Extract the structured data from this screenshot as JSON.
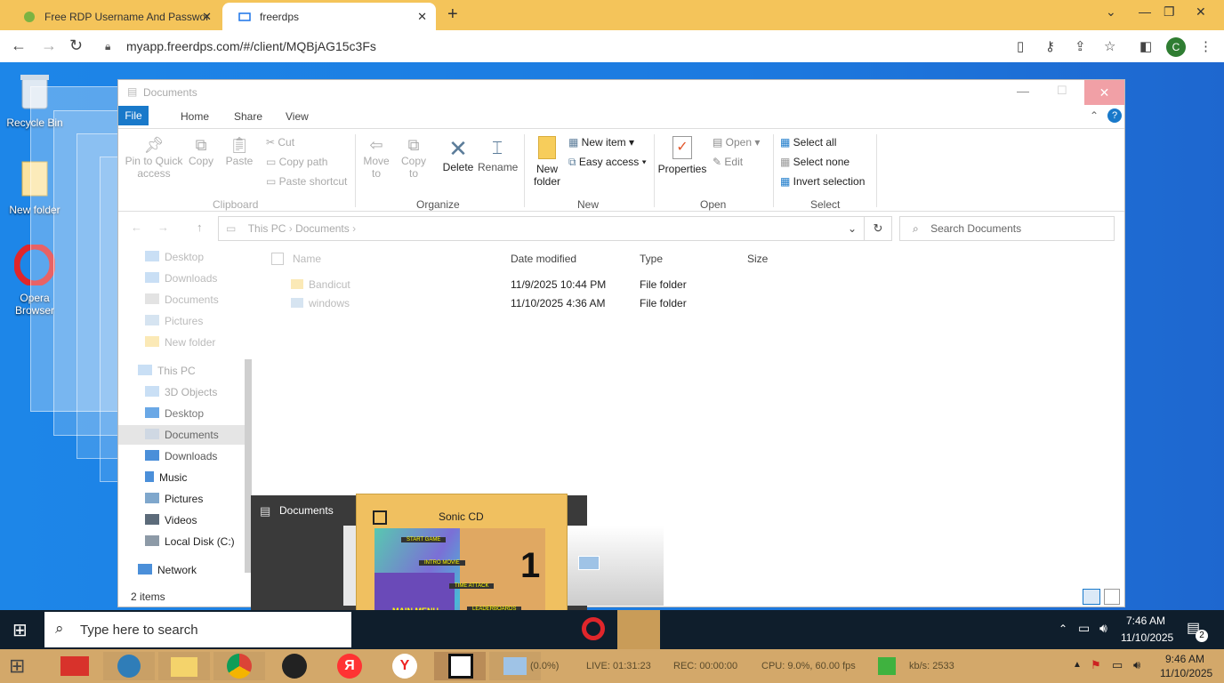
{
  "browser": {
    "tabs": [
      {
        "title": "Free RDP Username And Passwor"
      },
      {
        "title": "freerdps"
      }
    ],
    "url": "myapp.freerdps.com/#/client/MQBjAG15c3Fs",
    "profile_initial": "C",
    "accent_color": "#f4c45a"
  },
  "desktop": {
    "icons": [
      {
        "label": "Recycle Bin"
      },
      {
        "label": "New folder"
      },
      {
        "label": "Opera Browser"
      }
    ]
  },
  "explorer": {
    "title": "Documents",
    "ribbon_tabs": [
      "File",
      "Home",
      "Share",
      "View"
    ],
    "clipboard": {
      "pin_label": "Pin to Quick access",
      "copy_label": "Copy",
      "paste_label": "Paste",
      "cut_label": "Cut",
      "copy_path_label": "Copy path",
      "paste_shortcut_label": "Paste shortcut",
      "group_label": "Clipboard"
    },
    "organize": {
      "move_to_label": "Move to",
      "copy_to_label": "Copy to",
      "delete_label": "Delete",
      "rename_label": "Rename",
      "group_label": "Organize"
    },
    "new": {
      "new_folder_label": "New folder",
      "new_item_label": "New item",
      "easy_access_label": "Easy access",
      "group_label": "New"
    },
    "open": {
      "properties_label": "Properties",
      "open_label": "Open",
      "edit_label": "Edit",
      "group_label": "Open"
    },
    "select": {
      "select_all_label": "Select all",
      "select_none_label": "Select none",
      "invert_label": "Invert selection",
      "group_label": "Select"
    },
    "breadcrumb": [
      "This PC",
      "Documents"
    ],
    "search_placeholder": "Search Documents",
    "nav_items": [
      {
        "label": "Desktop"
      },
      {
        "label": "Downloads"
      },
      {
        "label": "Documents"
      },
      {
        "label": "Pictures"
      },
      {
        "label": "New folder"
      },
      {
        "label": "This PC"
      },
      {
        "label": "3D Objects"
      },
      {
        "label": "Desktop"
      },
      {
        "label": "Documents"
      },
      {
        "label": "Downloads"
      },
      {
        "label": "Music"
      },
      {
        "label": "Pictures"
      },
      {
        "label": "Videos"
      },
      {
        "label": "Local Disk (C:)"
      },
      {
        "label": "Network"
      }
    ],
    "columns": [
      "Name",
      "Date modified",
      "Type",
      "Size"
    ],
    "files": [
      {
        "name": "Bandicut",
        "date": "11/9/2025 10:44 PM",
        "type": "File folder"
      },
      {
        "name": "windows",
        "date": "11/10/2025 4:36 AM",
        "type": "File folder"
      }
    ],
    "status": "2 items"
  },
  "preview": {
    "documents_label": "Documents",
    "sonic_title": "Sonic CD",
    "menu_items": [
      "START GAME",
      "INTRO MOVIE",
      "TIME ATTACK",
      "LEADERBOARDS",
      "MAIN MENU"
    ],
    "big_number": "1"
  },
  "taskbar": {
    "search_placeholder": "Type here to search",
    "time": "7:46 AM",
    "date": "11/10/2025",
    "notification_count": "2"
  },
  "host_taskbar": {
    "fps_text": "(0.0%)",
    "live_text": "LIVE: 01:31:23",
    "rec_text": "REC: 00:00:00",
    "cpu_text": "CPU: 9.0%, 60.00 fps",
    "kbps_text": "kb/s: 2533",
    "time": "9:46 AM",
    "date": "11/10/2025",
    "yandex_letter": "Я",
    "yandex_browser_letter": "Y"
  }
}
